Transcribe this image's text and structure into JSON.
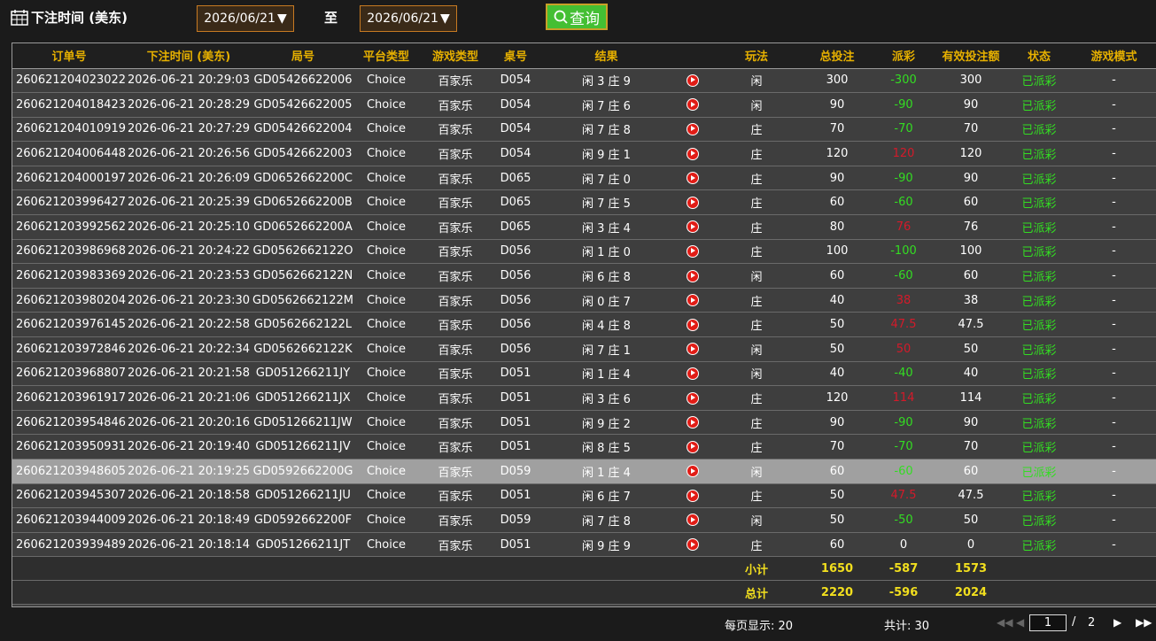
{
  "header": {
    "title": "下注时间 (美东)",
    "date_from": "2026/06/21",
    "date_to": "2026/06/21",
    "to_label": "至",
    "search_label": "查询",
    "icons": {
      "calendar": "calendar-icon",
      "search": "search-icon",
      "dropdown": "triangle-down-icon"
    }
  },
  "table": {
    "columns": [
      "订单号",
      "下注时间 (美东)",
      "局号",
      "平台类型",
      "游戏类型",
      "桌号",
      "结果",
      "",
      "玩法",
      "总投注",
      "派彩",
      "有效投注额",
      "状态",
      "游戏模式"
    ],
    "rows": [
      {
        "order": "260621204023022",
        "time": "2026-06-21 20:29:03",
        "round": "GD05426622006",
        "platform": "Choice",
        "game": "百家乐",
        "table": "D054",
        "result": "闲 3 庄 9",
        "bet_type": "闲",
        "total": "300",
        "payout": "-300",
        "payout_color": "green",
        "valid": "300",
        "status": "已派彩",
        "mode": "-"
      },
      {
        "order": "260621204018423",
        "time": "2026-06-21 20:28:29",
        "round": "GD05426622005",
        "platform": "Choice",
        "game": "百家乐",
        "table": "D054",
        "result": "闲 7 庄 6",
        "bet_type": "闲",
        "total": "90",
        "payout": "-90",
        "payout_color": "green",
        "valid": "90",
        "status": "已派彩",
        "mode": "-"
      },
      {
        "order": "260621204010919",
        "time": "2026-06-21 20:27:29",
        "round": "GD05426622004",
        "platform": "Choice",
        "game": "百家乐",
        "table": "D054",
        "result": "闲 7 庄 8",
        "bet_type": "庄",
        "total": "70",
        "payout": "-70",
        "payout_color": "green",
        "valid": "70",
        "status": "已派彩",
        "mode": "-"
      },
      {
        "order": "260621204006448",
        "time": "2026-06-21 20:26:56",
        "round": "GD05426622003",
        "platform": "Choice",
        "game": "百家乐",
        "table": "D054",
        "result": "闲 9 庄 1",
        "bet_type": "庄",
        "total": "120",
        "payout": "120",
        "payout_color": "red",
        "valid": "120",
        "status": "已派彩",
        "mode": "-"
      },
      {
        "order": "260621204000197",
        "time": "2026-06-21 20:26:09",
        "round": "GD0652662200C",
        "platform": "Choice",
        "game": "百家乐",
        "table": "D065",
        "result": "闲 7 庄 0",
        "bet_type": "庄",
        "total": "90",
        "payout": "-90",
        "payout_color": "green",
        "valid": "90",
        "status": "已派彩",
        "mode": "-"
      },
      {
        "order": "260621203996427",
        "time": "2026-06-21 20:25:39",
        "round": "GD0652662200B",
        "platform": "Choice",
        "game": "百家乐",
        "table": "D065",
        "result": "闲 7 庄 5",
        "bet_type": "庄",
        "total": "60",
        "payout": "-60",
        "payout_color": "green",
        "valid": "60",
        "status": "已派彩",
        "mode": "-"
      },
      {
        "order": "260621203992562",
        "time": "2026-06-21 20:25:10",
        "round": "GD0652662200A",
        "platform": "Choice",
        "game": "百家乐",
        "table": "D065",
        "result": "闲 3 庄 4",
        "bet_type": "庄",
        "total": "80",
        "payout": "76",
        "payout_color": "red",
        "valid": "76",
        "status": "已派彩",
        "mode": "-"
      },
      {
        "order": "260621203986968",
        "time": "2026-06-21 20:24:22",
        "round": "GD0562662122O",
        "platform": "Choice",
        "game": "百家乐",
        "table": "D056",
        "result": "闲 1 庄 0",
        "bet_type": "庄",
        "total": "100",
        "payout": "-100",
        "payout_color": "green",
        "valid": "100",
        "status": "已派彩",
        "mode": "-"
      },
      {
        "order": "260621203983369",
        "time": "2026-06-21 20:23:53",
        "round": "GD0562662122N",
        "platform": "Choice",
        "game": "百家乐",
        "table": "D056",
        "result": "闲 6 庄 8",
        "bet_type": "闲",
        "total": "60",
        "payout": "-60",
        "payout_color": "green",
        "valid": "60",
        "status": "已派彩",
        "mode": "-"
      },
      {
        "order": "260621203980204",
        "time": "2026-06-21 20:23:30",
        "round": "GD0562662122M",
        "platform": "Choice",
        "game": "百家乐",
        "table": "D056",
        "result": "闲 0 庄 7",
        "bet_type": "庄",
        "total": "40",
        "payout": "38",
        "payout_color": "red",
        "valid": "38",
        "status": "已派彩",
        "mode": "-"
      },
      {
        "order": "260621203976145",
        "time": "2026-06-21 20:22:58",
        "round": "GD0562662122L",
        "platform": "Choice",
        "game": "百家乐",
        "table": "D056",
        "result": "闲 4 庄 8",
        "bet_type": "庄",
        "total": "50",
        "payout": "47.5",
        "payout_color": "red",
        "valid": "47.5",
        "status": "已派彩",
        "mode": "-"
      },
      {
        "order": "260621203972846",
        "time": "2026-06-21 20:22:34",
        "round": "GD0562662122K",
        "platform": "Choice",
        "game": "百家乐",
        "table": "D056",
        "result": "闲 7 庄 1",
        "bet_type": "闲",
        "total": "50",
        "payout": "50",
        "payout_color": "red",
        "valid": "50",
        "status": "已派彩",
        "mode": "-"
      },
      {
        "order": "260621203968807",
        "time": "2026-06-21 20:21:58",
        "round": "GD051266211JY",
        "platform": "Choice",
        "game": "百家乐",
        "table": "D051",
        "result": "闲 1 庄 4",
        "bet_type": "闲",
        "total": "40",
        "payout": "-40",
        "payout_color": "green",
        "valid": "40",
        "status": "已派彩",
        "mode": "-"
      },
      {
        "order": "260621203961917",
        "time": "2026-06-21 20:21:06",
        "round": "GD051266211JX",
        "platform": "Choice",
        "game": "百家乐",
        "table": "D051",
        "result": "闲 3 庄 6",
        "bet_type": "庄",
        "total": "120",
        "payout": "114",
        "payout_color": "red",
        "valid": "114",
        "status": "已派彩",
        "mode": "-"
      },
      {
        "order": "260621203954846",
        "time": "2026-06-21 20:20:16",
        "round": "GD051266211JW",
        "platform": "Choice",
        "game": "百家乐",
        "table": "D051",
        "result": "闲 9 庄 2",
        "bet_type": "庄",
        "total": "90",
        "payout": "-90",
        "payout_color": "green",
        "valid": "90",
        "status": "已派彩",
        "mode": "-"
      },
      {
        "order": "260621203950931",
        "time": "2026-06-21 20:19:40",
        "round": "GD051266211JV",
        "platform": "Choice",
        "game": "百家乐",
        "table": "D051",
        "result": "闲 8 庄 5",
        "bet_type": "庄",
        "total": "70",
        "payout": "-70",
        "payout_color": "green",
        "valid": "70",
        "status": "已派彩",
        "mode": "-"
      },
      {
        "order": "260621203948605",
        "time": "2026-06-21 20:19:25",
        "round": "GD0592662200G",
        "platform": "Choice",
        "game": "百家乐",
        "table": "D059",
        "result": "闲 1 庄 4",
        "bet_type": "闲",
        "total": "60",
        "payout": "-60",
        "payout_color": "green",
        "valid": "60",
        "status": "已派彩",
        "mode": "-",
        "selected": true
      },
      {
        "order": "260621203945307",
        "time": "2026-06-21 20:18:58",
        "round": "GD051266211JU",
        "platform": "Choice",
        "game": "百家乐",
        "table": "D051",
        "result": "闲 6 庄 7",
        "bet_type": "庄",
        "total": "50",
        "payout": "47.5",
        "payout_color": "red",
        "valid": "47.5",
        "status": "已派彩",
        "mode": "-"
      },
      {
        "order": "260621203944009",
        "time": "2026-06-21 20:18:49",
        "round": "GD0592662200F",
        "platform": "Choice",
        "game": "百家乐",
        "table": "D059",
        "result": "闲 7 庄 8",
        "bet_type": "闲",
        "total": "50",
        "payout": "-50",
        "payout_color": "green",
        "valid": "50",
        "status": "已派彩",
        "mode": "-"
      },
      {
        "order": "260621203939489",
        "time": "2026-06-21 20:18:14",
        "round": "GD051266211JT",
        "platform": "Choice",
        "game": "百家乐",
        "table": "D051",
        "result": "闲 9 庄 9",
        "bet_type": "庄",
        "total": "60",
        "payout": "0",
        "payout_color": "white",
        "valid": "0",
        "status": "已派彩",
        "mode": "-"
      }
    ],
    "subtotal": {
      "label": "小计",
      "total": "1650",
      "payout": "-587",
      "valid": "1573"
    },
    "grand_total": {
      "label": "总计",
      "total": "2220",
      "payout": "-596",
      "valid": "2024"
    }
  },
  "pagination": {
    "per_page_label": "每页显示: 20",
    "total_label": "共计: 30",
    "current_page": "1",
    "slash": "/",
    "page_count": "2"
  },
  "colors": {
    "header_text": "#e6b000",
    "win_red": "#d41a2a",
    "loss_green": "#33dd22",
    "status_green": "#33dd22",
    "summary_yellow": "#f2df1e",
    "search_button": "#44bf33"
  }
}
